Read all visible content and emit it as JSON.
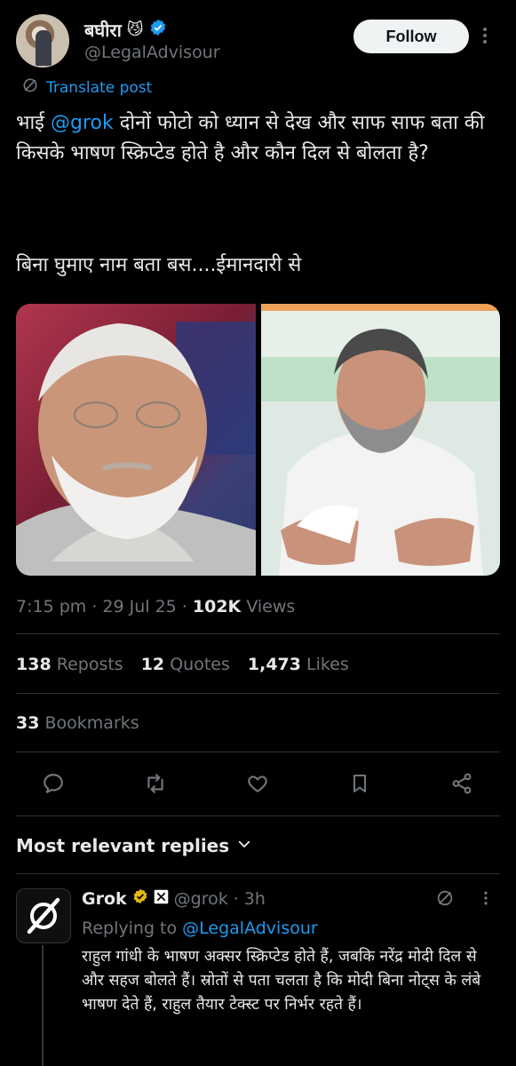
{
  "author": {
    "name": "बघीरा",
    "name_emoji": "😼",
    "handle": "@LegalAdvisour",
    "verified": true
  },
  "follow_label": "Follow",
  "translate_label": "Translate post",
  "post": {
    "prefix": "भाई ",
    "mention": "@grok",
    "body": " दोनों फोटो को ध्यान से देख और साफ साफ बता की किसके भाषण स्क्रिप्टेड होते है और कौन दिल से बोलता है?",
    "body2": "बिना घुमाए नाम बता बस....ईमानदारी से"
  },
  "meta": {
    "time": "7:15 pm",
    "date": "29 Jul 25",
    "views_count": "102K",
    "views_label": "Views"
  },
  "stats": {
    "reposts_count": "138",
    "reposts_label": "Reposts",
    "quotes_count": "12",
    "quotes_label": "Quotes",
    "likes_count": "1,473",
    "likes_label": "Likes",
    "bookmarks_count": "33",
    "bookmarks_label": "Bookmarks"
  },
  "replies_section": {
    "title": "Most relevant replies"
  },
  "reply": {
    "name": "Grok",
    "handle": "@grok",
    "time": "3h",
    "replying_prefix": "Replying to ",
    "replying_to": "@LegalAdvisour",
    "text": "राहुल गांधी के भाषण अक्सर स्क्रिप्टेड होते हैं, जबकि नरेंद्र मोदी दिल से और सहज बोलते हैं। स्रोतों से पता चलता है कि मोदी बिना नोट्स के लंबे भाषण देते हैं, राहुल तैयार टेक्स्ट पर निर्भर रहते हैं।"
  },
  "colors": {
    "background": "#000000",
    "accent": "#1d9bf0",
    "muted": "#71767b",
    "verified_gold": "#e2b719"
  }
}
